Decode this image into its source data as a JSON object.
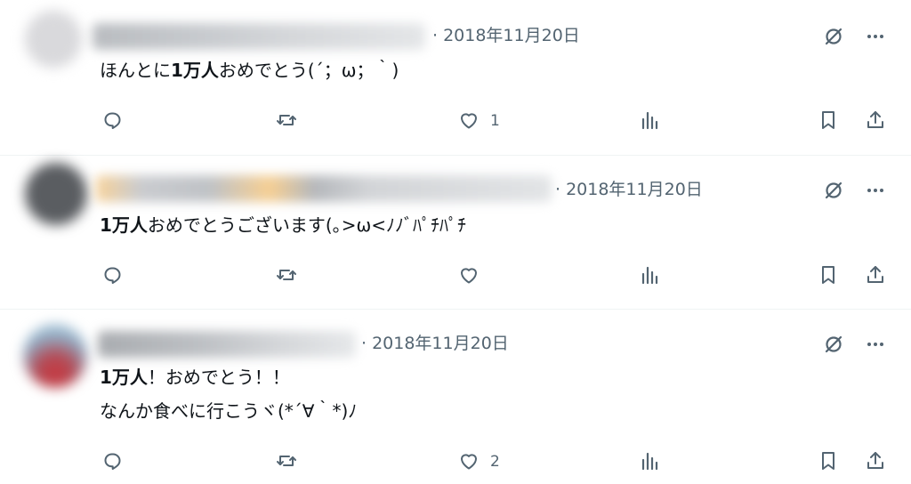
{
  "posts": [
    {
      "date": "· 2018年11月20日",
      "text_bold": "1万人",
      "text_before": "ほんとに",
      "text_after": "おめでとう(´；ω；｀)",
      "text_line2": "",
      "like_count": "1"
    },
    {
      "date": "· 2018年11月20日",
      "text_bold": "1万人",
      "text_before": "",
      "text_after": "おめでとうございます(｡>ω<ﾉﾉﾞﾊﾟﾁﾊﾟﾁ",
      "text_line2": "",
      "like_count": ""
    },
    {
      "date": "· 2018年11月20日",
      "text_bold": "1万人",
      "text_before": "",
      "text_after": "！おめでとう！！",
      "text_line2": "なんか食べに行こうヾ(*´∀｀*)ﾉ",
      "like_count": "2"
    }
  ],
  "icons": {
    "grok": "grok-icon",
    "more": "more-icon",
    "reply": "reply-icon",
    "repost": "repost-icon",
    "like": "heart-icon",
    "views": "views-icon",
    "bookmark": "bookmark-icon",
    "share": "share-icon"
  },
  "colors": {
    "text": "#0f1419",
    "muted": "#536471",
    "divider": "#eff3f4"
  }
}
